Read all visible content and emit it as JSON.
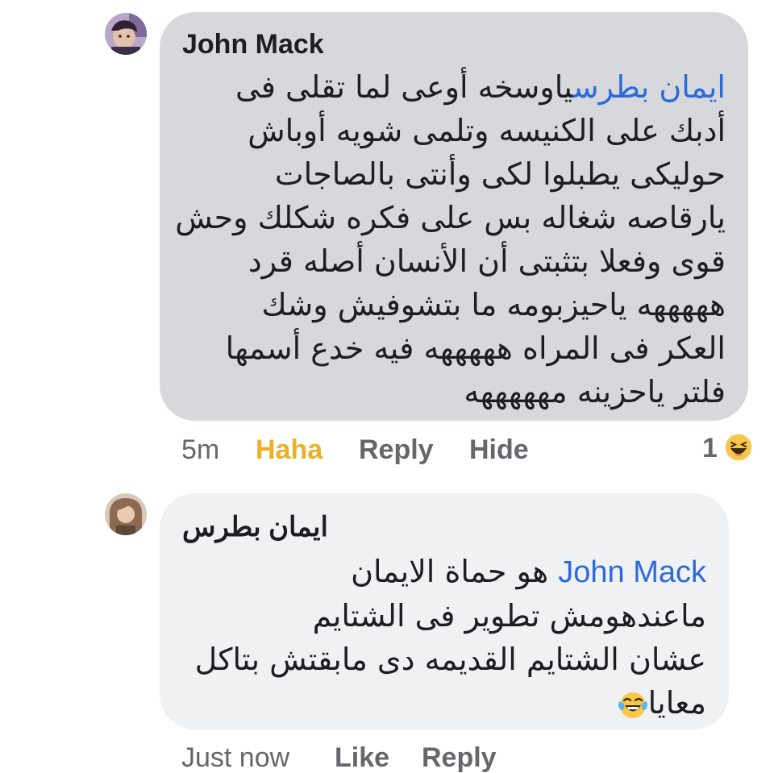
{
  "comments": [
    {
      "author": "John Mack",
      "mention": "ايمان بطرس",
      "lines": [
        "ياوسخه أوعى لما تقلى فى",
        "أدبك على الكنيسه وتلمى شويه أوباش",
        "حوليكى يطبلوا لكى وأنتى بالصاجات",
        "يارقاصه شغاله بس على فكره شكلك وحش",
        "قوى وفعلا بتثبتى أن الأنسان أصله قرد",
        "هههههه ياحيزبومه ما بتشوفيش وشك",
        "العكر فى المراه هههههه فيه خدع أسمها",
        "فلتر ياحزينه مهههههه"
      ],
      "time": "5m",
      "actions": [
        "Haha",
        "Reply",
        "Hide"
      ],
      "reaction_count": "1",
      "reaction_icon": "haha-emoji-icon"
    },
    {
      "author": "ايمان بطرس",
      "mention": "John Mack",
      "lines": [
        "هو حماة الايمان",
        "ماعندهومش تطوير فى الشتايم",
        "عشان الشتايم القديمه دى مابقتش بتاكل",
        "معايا"
      ],
      "trailing_icon": "tears-of-joy-emoji-icon",
      "time": "Just now",
      "actions": [
        "Like",
        "Reply"
      ]
    }
  ],
  "colors": {
    "bubble_1": "#d7d8db",
    "bubble_2": "#f0f1f3",
    "mention": "#2d6ad9",
    "haha_active": "#eab026",
    "meta": "#65676b"
  }
}
